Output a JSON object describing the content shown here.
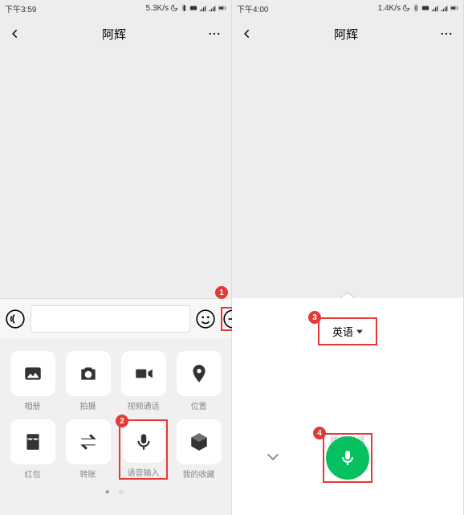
{
  "left": {
    "status": {
      "time": "下午3:59",
      "speed": "5.3K/s"
    },
    "nav": {
      "title": "阿辉"
    },
    "grid": [
      {
        "name": "album",
        "label": "相册"
      },
      {
        "name": "camera",
        "label": "拍摄"
      },
      {
        "name": "video-call",
        "label": "视频通话"
      },
      {
        "name": "location",
        "label": "位置"
      },
      {
        "name": "red-packet",
        "label": "红包"
      },
      {
        "name": "transfer",
        "label": "转账"
      },
      {
        "name": "voice-input",
        "label": "语音输入"
      },
      {
        "name": "favorites",
        "label": "我的收藏"
      }
    ],
    "badges": {
      "b1": "1",
      "b2": "2"
    }
  },
  "right": {
    "status": {
      "time": "下午4:00",
      "speed": "1.4K/s"
    },
    "nav": {
      "title": "阿辉"
    },
    "lang": "英语",
    "hold_text": "按住说话",
    "badges": {
      "b3": "3",
      "b4": "4"
    }
  }
}
